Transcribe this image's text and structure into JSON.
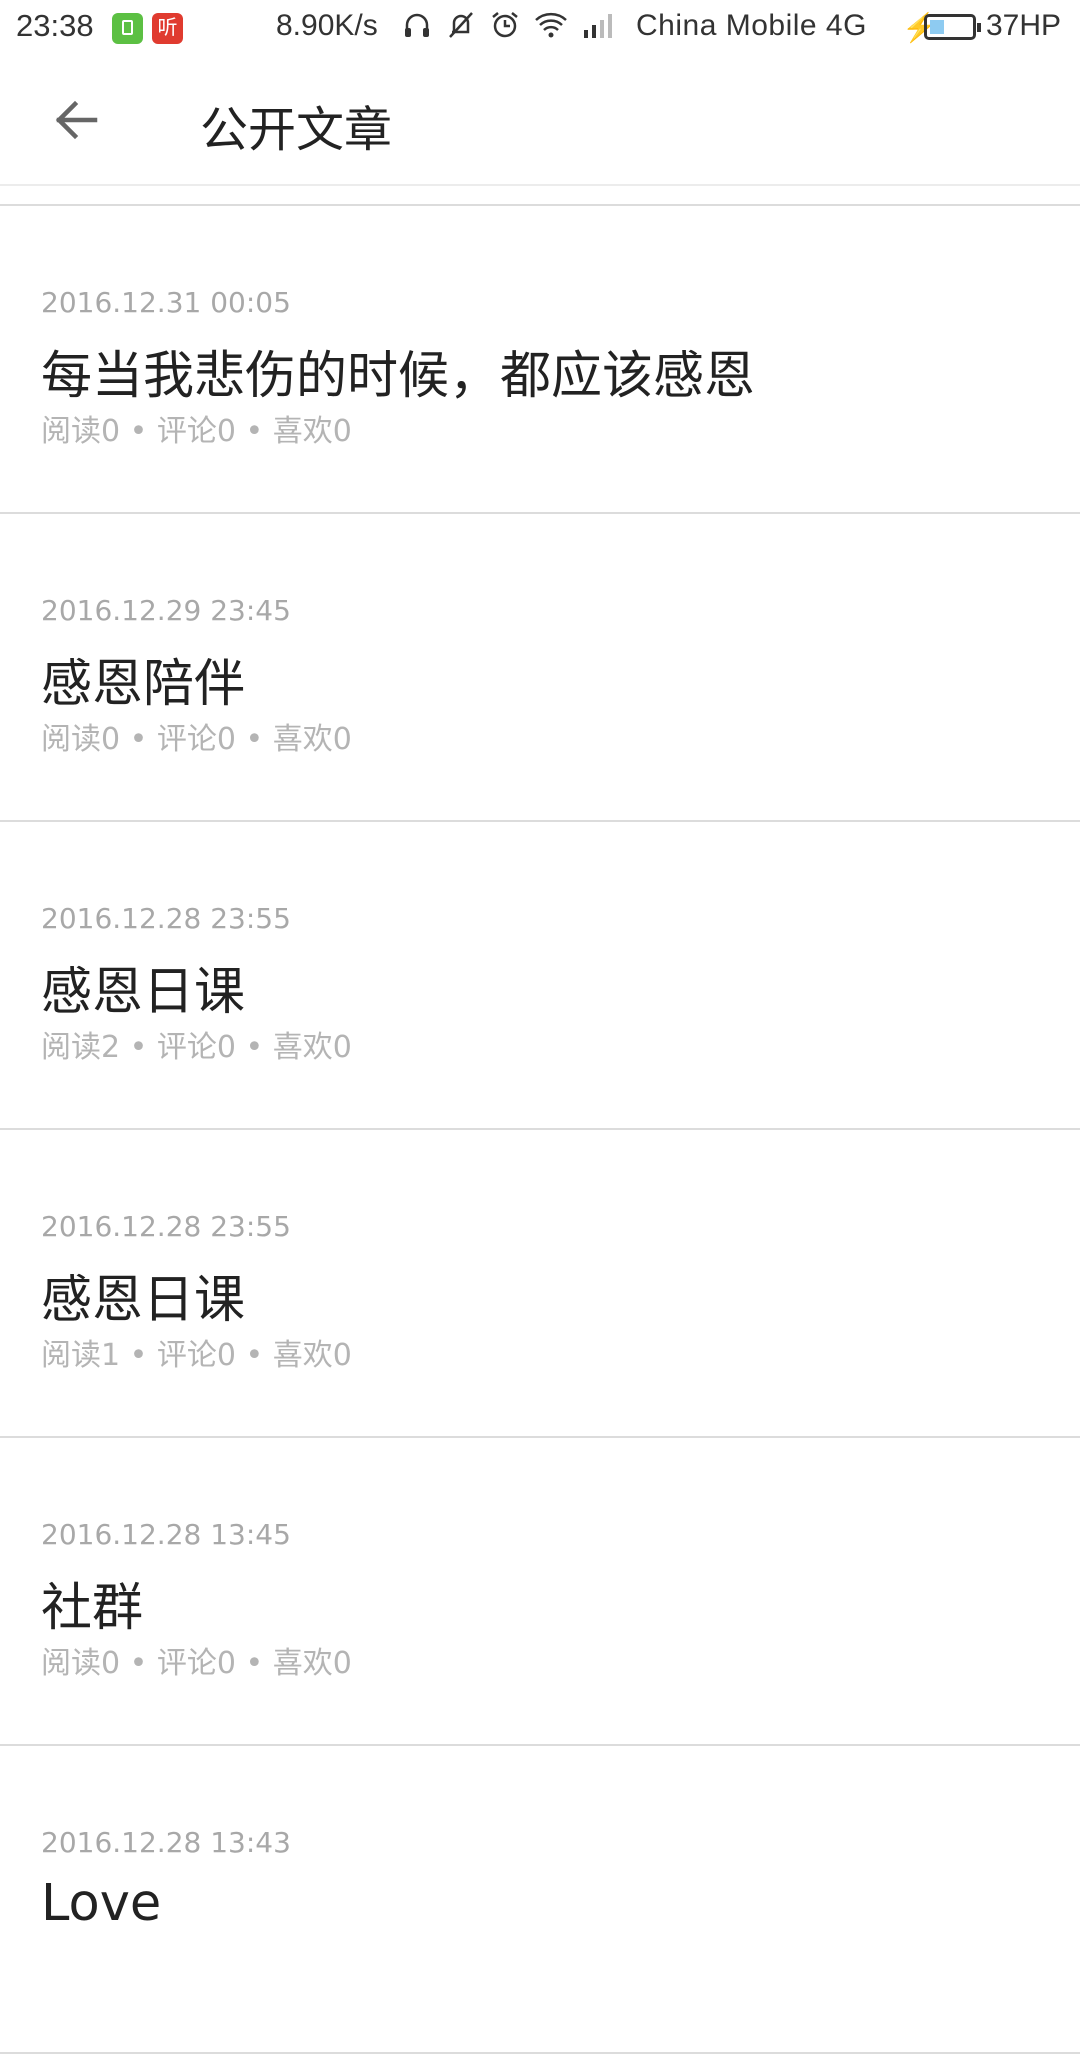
{
  "status_bar": {
    "time": "23:38",
    "app_icon_red_label": "听",
    "net_speed": "8.90K/s",
    "icons": [
      "headphones-icon",
      "bell-off-icon",
      "alarm-icon",
      "wifi-icon",
      "signal-icon"
    ],
    "carrier": "China Mobile 4G",
    "battery": "37HP"
  },
  "header": {
    "title": "公开文章"
  },
  "articles": [
    {
      "date": "2016.12.31 00:05",
      "title": "每当我悲伤的时候，都应该感恩",
      "stats": "阅读0 • 评论0 • 喜欢0"
    },
    {
      "date": "2016.12.29 23:45",
      "title": "感恩陪伴",
      "stats": "阅读0 • 评论0 • 喜欢0"
    },
    {
      "date": "2016.12.28 23:55",
      "title": "感恩日课",
      "stats": "阅读2 • 评论0 • 喜欢0"
    },
    {
      "date": "2016.12.28 23:55",
      "title": "感恩日课",
      "stats": "阅读1 • 评论0 • 喜欢0"
    },
    {
      "date": "2016.12.28 13:45",
      "title": "社群",
      "stats": "阅读0 • 评论0 • 喜欢0"
    },
    {
      "date": "2016.12.28 13:43",
      "title": "Love",
      "stats": ""
    }
  ]
}
